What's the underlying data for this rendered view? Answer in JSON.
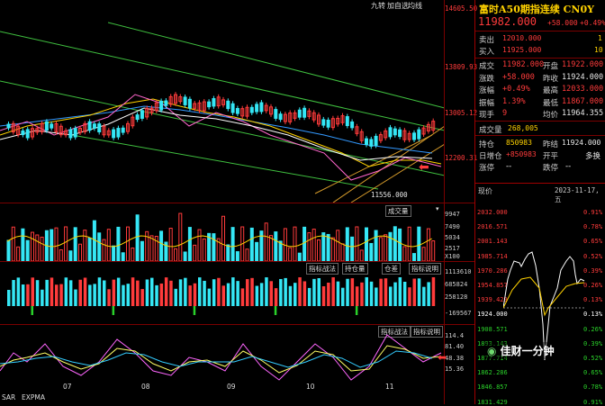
{
  "toolbar": {
    "btn1": "九转",
    "btn2": "加自选",
    "btn3": "均线"
  },
  "quote": {
    "title": "富时A50期指连续 CN0Y",
    "price": "11982.000",
    "change": "+58.000",
    "change_pct": "+0.49%",
    "sell_label": "卖出",
    "sell_price": "12010.000",
    "sell_qty": "1",
    "buy_label": "买入",
    "buy_price": "11925.000",
    "buy_qty": "10",
    "rows": [
      {
        "l1": "成交",
        "v1": "11982.000",
        "l2": "开盘",
        "v2": "11922.000"
      },
      {
        "l1": "涨跌",
        "v1": "+58.000",
        "l2": "昨收",
        "v2": "11924.000"
      },
      {
        "l1": "涨幅",
        "v1": "+0.49%",
        "l2": "最高",
        "v2": "12033.000"
      },
      {
        "l1": "振幅",
        "v1": "1.39%",
        "l2": "最低",
        "v2": "11867.000"
      },
      {
        "l1": "现手",
        "v1": "9",
        "l2": "均价",
        "v2": "11964.355"
      }
    ],
    "volume_label": "成交量",
    "volume": "268,005",
    "oi_label": "持仓",
    "oi": "850983",
    "prev_settle_label": "昨结",
    "prev_settle": "11924.000",
    "daily_oi_label": "日增仓",
    "daily_oi": "+850983",
    "open_flat_label": "开平",
    "open_flat": "多换",
    "updown_label": "涨停",
    "updown": "--",
    "limit_down_label": "跌停",
    "limit_down": "--"
  },
  "intraday": {
    "label": "现价",
    "date": "2023-11-17,五",
    "price_ticks": [
      "2032.000",
      "2016.571",
      "2001.143",
      "1985.714",
      "1970.286",
      "1954.857",
      "1939.429",
      "1924.000",
      "1908.571",
      "1893.143",
      "1877.714",
      "1862.286",
      "1846.857",
      "1831.429"
    ],
    "pct_ticks": [
      "0.91%",
      "0.78%",
      "0.65%",
      "0.52%",
      "0.39%",
      "0.26%",
      "0.13%",
      "0.13%",
      "0.26%",
      "0.39%",
      "0.52%",
      "0.65%",
      "0.78%",
      "0.91%"
    ]
  },
  "main_chart": {
    "axis_prices": [
      "14605.50",
      "13809.93",
      "13005.12",
      "12200.31"
    ],
    "low_marker": "11556.000",
    "month_labels": [
      "07",
      "08",
      "09",
      "10",
      "11"
    ],
    "labels_nums": [
      "9",
      "8",
      "7",
      "6",
      "3",
      "2",
      "1"
    ]
  },
  "volume_panel": {
    "select": "成交量",
    "ticks": [
      "9947",
      "7490",
      "5034",
      "2517",
      "X100"
    ]
  },
  "oi_panel": {
    "tab1": "指标战法",
    "tab2": "持仓量",
    "tab3": "仓差",
    "tab4": "指标说明",
    "ticks": [
      "1113610",
      "685824",
      "258128",
      "-169567"
    ]
  },
  "kd_panel": {
    "tab1": "指标战法",
    "tab2": "指标说明",
    "ticks": [
      "114.4",
      "81.40",
      "48.38",
      "15.36"
    ]
  },
  "bottom_tabs": {
    "t1": "SAR",
    "t2": "EXPMA"
  },
  "watermark": "佳财一分钟",
  "colors": {
    "up": "#ff3b3b",
    "down": "#35e7f5",
    "grid": "#7a0000",
    "ma": "#ffd200"
  }
}
